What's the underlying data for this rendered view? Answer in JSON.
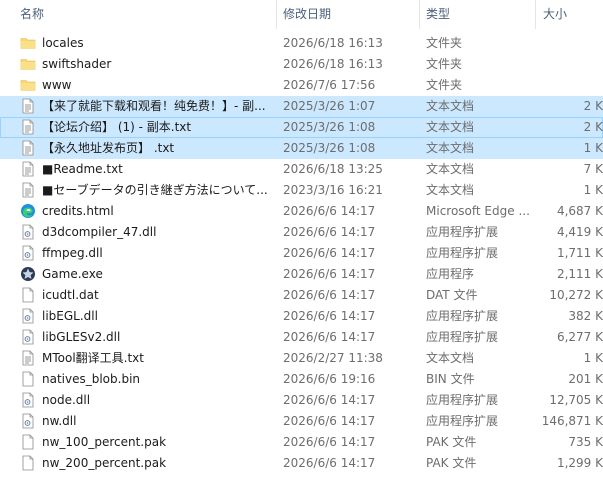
{
  "columns": {
    "name": "名称",
    "date": "修改日期",
    "type": "类型",
    "size": "大小"
  },
  "files": [
    {
      "name": "locales",
      "date": "2026/6/18 16:13",
      "type": "文件夹",
      "size": "",
      "icon": "folder-icon",
      "selected": false
    },
    {
      "name": "swiftshader",
      "date": "2026/6/18 16:13",
      "type": "文件夹",
      "size": "",
      "icon": "folder-icon",
      "selected": false
    },
    {
      "name": "www",
      "date": "2026/7/6 17:56",
      "type": "文件夹",
      "size": "",
      "icon": "folder-icon",
      "selected": false
    },
    {
      "name": "【来了就能下载和观看！纯免费！】- 副...",
      "date": "2025/3/26 1:07",
      "type": "文本文档",
      "size": "2 K",
      "icon": "text-file-icon",
      "selected": true
    },
    {
      "name": "【论坛介绍】 (1) - 副本.txt",
      "date": "2025/3/26 1:08",
      "type": "文本文档",
      "size": "2 K",
      "icon": "text-file-icon",
      "selected": true,
      "focus": true
    },
    {
      "name": "【永久地址发布页】 .txt",
      "date": "2025/3/26 1:08",
      "type": "文本文档",
      "size": "1 K",
      "icon": "text-file-icon",
      "selected": true
    },
    {
      "name": "■Readme.txt",
      "date": "2026/6/18 13:25",
      "type": "文本文档",
      "size": "7 K",
      "icon": "text-file-icon",
      "selected": false
    },
    {
      "name": "■セーブデータの引き継ぎ方法について...",
      "date": "2023/3/16 16:21",
      "type": "文本文档",
      "size": "1 K",
      "icon": "text-file-icon",
      "selected": false
    },
    {
      "name": "credits.html",
      "date": "2026/6/6 14:17",
      "type": "Microsoft Edge ...",
      "size": "4,687 K",
      "icon": "edge-icon",
      "selected": false
    },
    {
      "name": "d3dcompiler_47.dll",
      "date": "2026/6/6 14:17",
      "type": "应用程序扩展",
      "size": "4,419 K",
      "icon": "dll-file-icon",
      "selected": false
    },
    {
      "name": "ffmpeg.dll",
      "date": "2026/6/6 14:17",
      "type": "应用程序扩展",
      "size": "1,711 K",
      "icon": "dll-file-icon",
      "selected": false
    },
    {
      "name": "Game.exe",
      "date": "2026/6/6 14:17",
      "type": "应用程序",
      "size": "2,111 K",
      "icon": "game-exe-icon",
      "selected": false
    },
    {
      "name": "icudtl.dat",
      "date": "2026/6/6 14:17",
      "type": "DAT 文件",
      "size": "10,272 K",
      "icon": "blank-file-icon",
      "selected": false
    },
    {
      "name": "libEGL.dll",
      "date": "2026/6/6 14:17",
      "type": "应用程序扩展",
      "size": "382 K",
      "icon": "dll-file-icon",
      "selected": false
    },
    {
      "name": "libGLESv2.dll",
      "date": "2026/6/6 14:17",
      "type": "应用程序扩展",
      "size": "6,277 K",
      "icon": "dll-file-icon",
      "selected": false
    },
    {
      "name": "MTool翻译工具.txt",
      "date": "2026/2/27 11:38",
      "type": "文本文档",
      "size": "1 K",
      "icon": "text-file-icon",
      "selected": false
    },
    {
      "name": "natives_blob.bin",
      "date": "2026/6/6 19:16",
      "type": "BIN 文件",
      "size": "201 K",
      "icon": "blank-file-icon",
      "selected": false
    },
    {
      "name": "node.dll",
      "date": "2026/6/6 14:17",
      "type": "应用程序扩展",
      "size": "12,705 K",
      "icon": "dll-file-icon",
      "selected": false
    },
    {
      "name": "nw.dll",
      "date": "2026/6/6 14:17",
      "type": "应用程序扩展",
      "size": "146,871 K",
      "icon": "dll-file-icon",
      "selected": false
    },
    {
      "name": "nw_100_percent.pak",
      "date": "2026/6/6 14:17",
      "type": "PAK 文件",
      "size": "735 K",
      "icon": "blank-file-icon",
      "selected": false
    },
    {
      "name": "nw_200_percent.pak",
      "date": "2026/6/6 14:17",
      "type": "PAK 文件",
      "size": "1,299 K",
      "icon": "blank-file-icon",
      "selected": false
    }
  ],
  "colors": {
    "selection": "#cce8ff",
    "selection_border": "#99d1ff",
    "header_text": "#4c607a",
    "folder": "#f8d775"
  }
}
